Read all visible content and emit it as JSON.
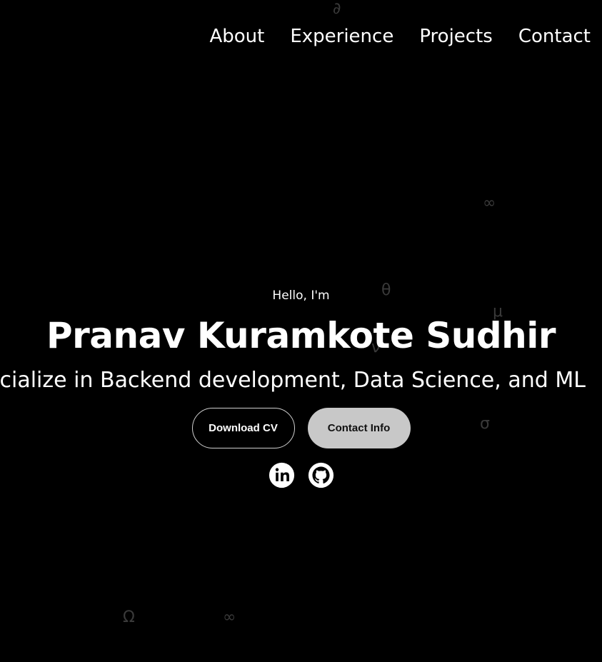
{
  "nav": {
    "items": [
      {
        "label": "About"
      },
      {
        "label": "Experience"
      },
      {
        "label": "Projects"
      },
      {
        "label": "Contact"
      }
    ]
  },
  "hero": {
    "greeting": "Hello, I'm",
    "name": "Pranav Kuramkote Sudhir",
    "tagline": "I specialize in Backend development, Data Science, and ML"
  },
  "buttons": {
    "download_cv": "Download CV",
    "contact_info": "Contact Info"
  },
  "socials": [
    {
      "icon": "linkedin-icon"
    },
    {
      "icon": "github-icon"
    }
  ],
  "background_symbols": [
    "∂",
    "∞",
    "θ",
    "μ",
    "ν",
    "σ",
    "Ω",
    "∞"
  ],
  "colors": {
    "background": "#000000",
    "text": "#ffffff",
    "button_filled": "#c8c8c8",
    "button_outline": "#cfcfcf",
    "symbol": "#3a3a3a"
  }
}
